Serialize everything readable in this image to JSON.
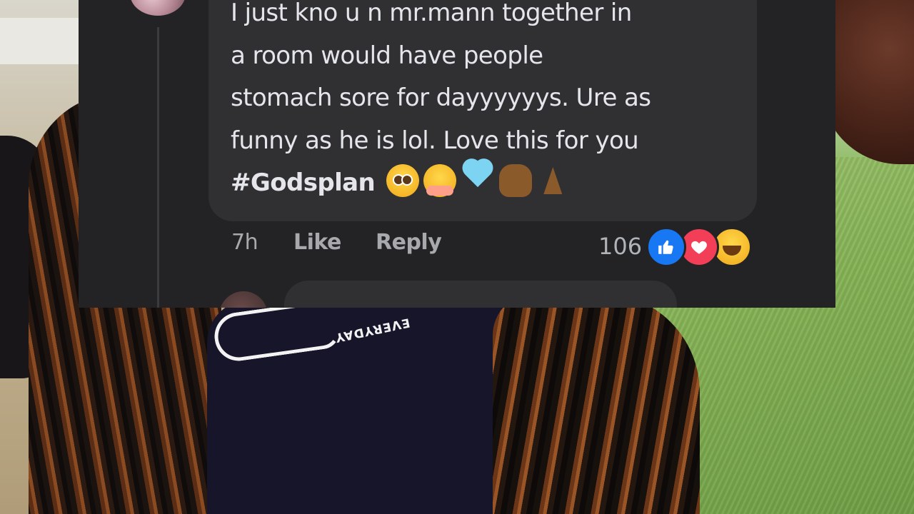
{
  "background_photo": {
    "shirt_text": "EVERYDAY"
  },
  "comment": {
    "lines": [
      "I just kno u n mr.mann together in",
      "a room would have people",
      "stomach sore for dayyyyyys. Ure as",
      "funny as he is lol. Love this for you"
    ],
    "hashtag": "#Godsplan",
    "emojis": [
      "pleading-face",
      "hugging-face",
      "light-blue-heart",
      "raised-fist-medium-dark",
      "folded-hands-medium-dark"
    ]
  },
  "actions": {
    "time": "7h",
    "like_label": "Like",
    "reply_label": "Reply"
  },
  "reactions": {
    "count": "106",
    "types": [
      "like",
      "love",
      "haha"
    ],
    "colors": {
      "like": "#1877f2",
      "love": "#f33e58",
      "haha": "#f7b125"
    }
  },
  "theme": {
    "card_bg": "#232325",
    "bubble_bg": "#303032",
    "text": "#e4e6eb",
    "muted": "#a8a9ad"
  }
}
